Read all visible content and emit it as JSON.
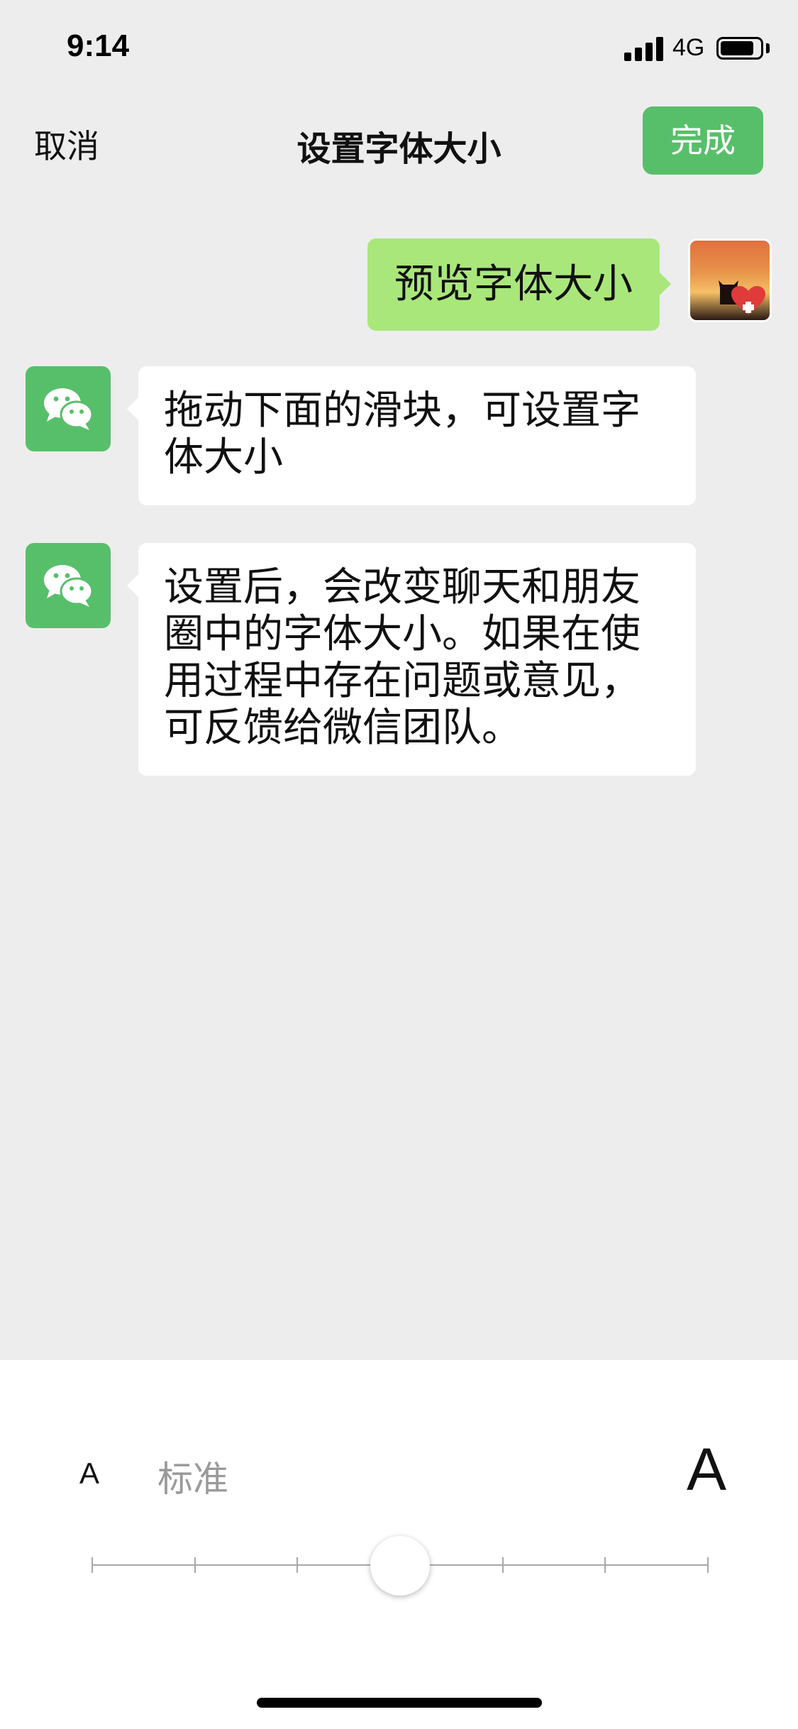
{
  "status_bar": {
    "time": "9:14",
    "network": "4G",
    "signal_bars": 4,
    "battery_level": 0.85
  },
  "nav": {
    "cancel_label": "取消",
    "title": "设置字体大小",
    "done_label": "完成"
  },
  "messages": {
    "preview": "预览字体大小",
    "tip1": "拖动下面的滑块，可设置字体大小",
    "tip2": "设置后，会改变聊天和朋友圈中的字体大小。如果在使用过程中存在问题或意见，可反馈给微信团队。"
  },
  "font_size_control": {
    "small_label": "A",
    "current_label": "标准",
    "large_label": "A",
    "steps": 7,
    "selected_step": 3
  },
  "colors": {
    "accent_green": "#57bf6a",
    "bubble_self": "#a9e77b",
    "background": "#ededed",
    "panel": "#ffffff"
  },
  "icons": {
    "wechat_avatar": "wechat-logo-icon",
    "self_avatar": "user-avatar-photo"
  }
}
